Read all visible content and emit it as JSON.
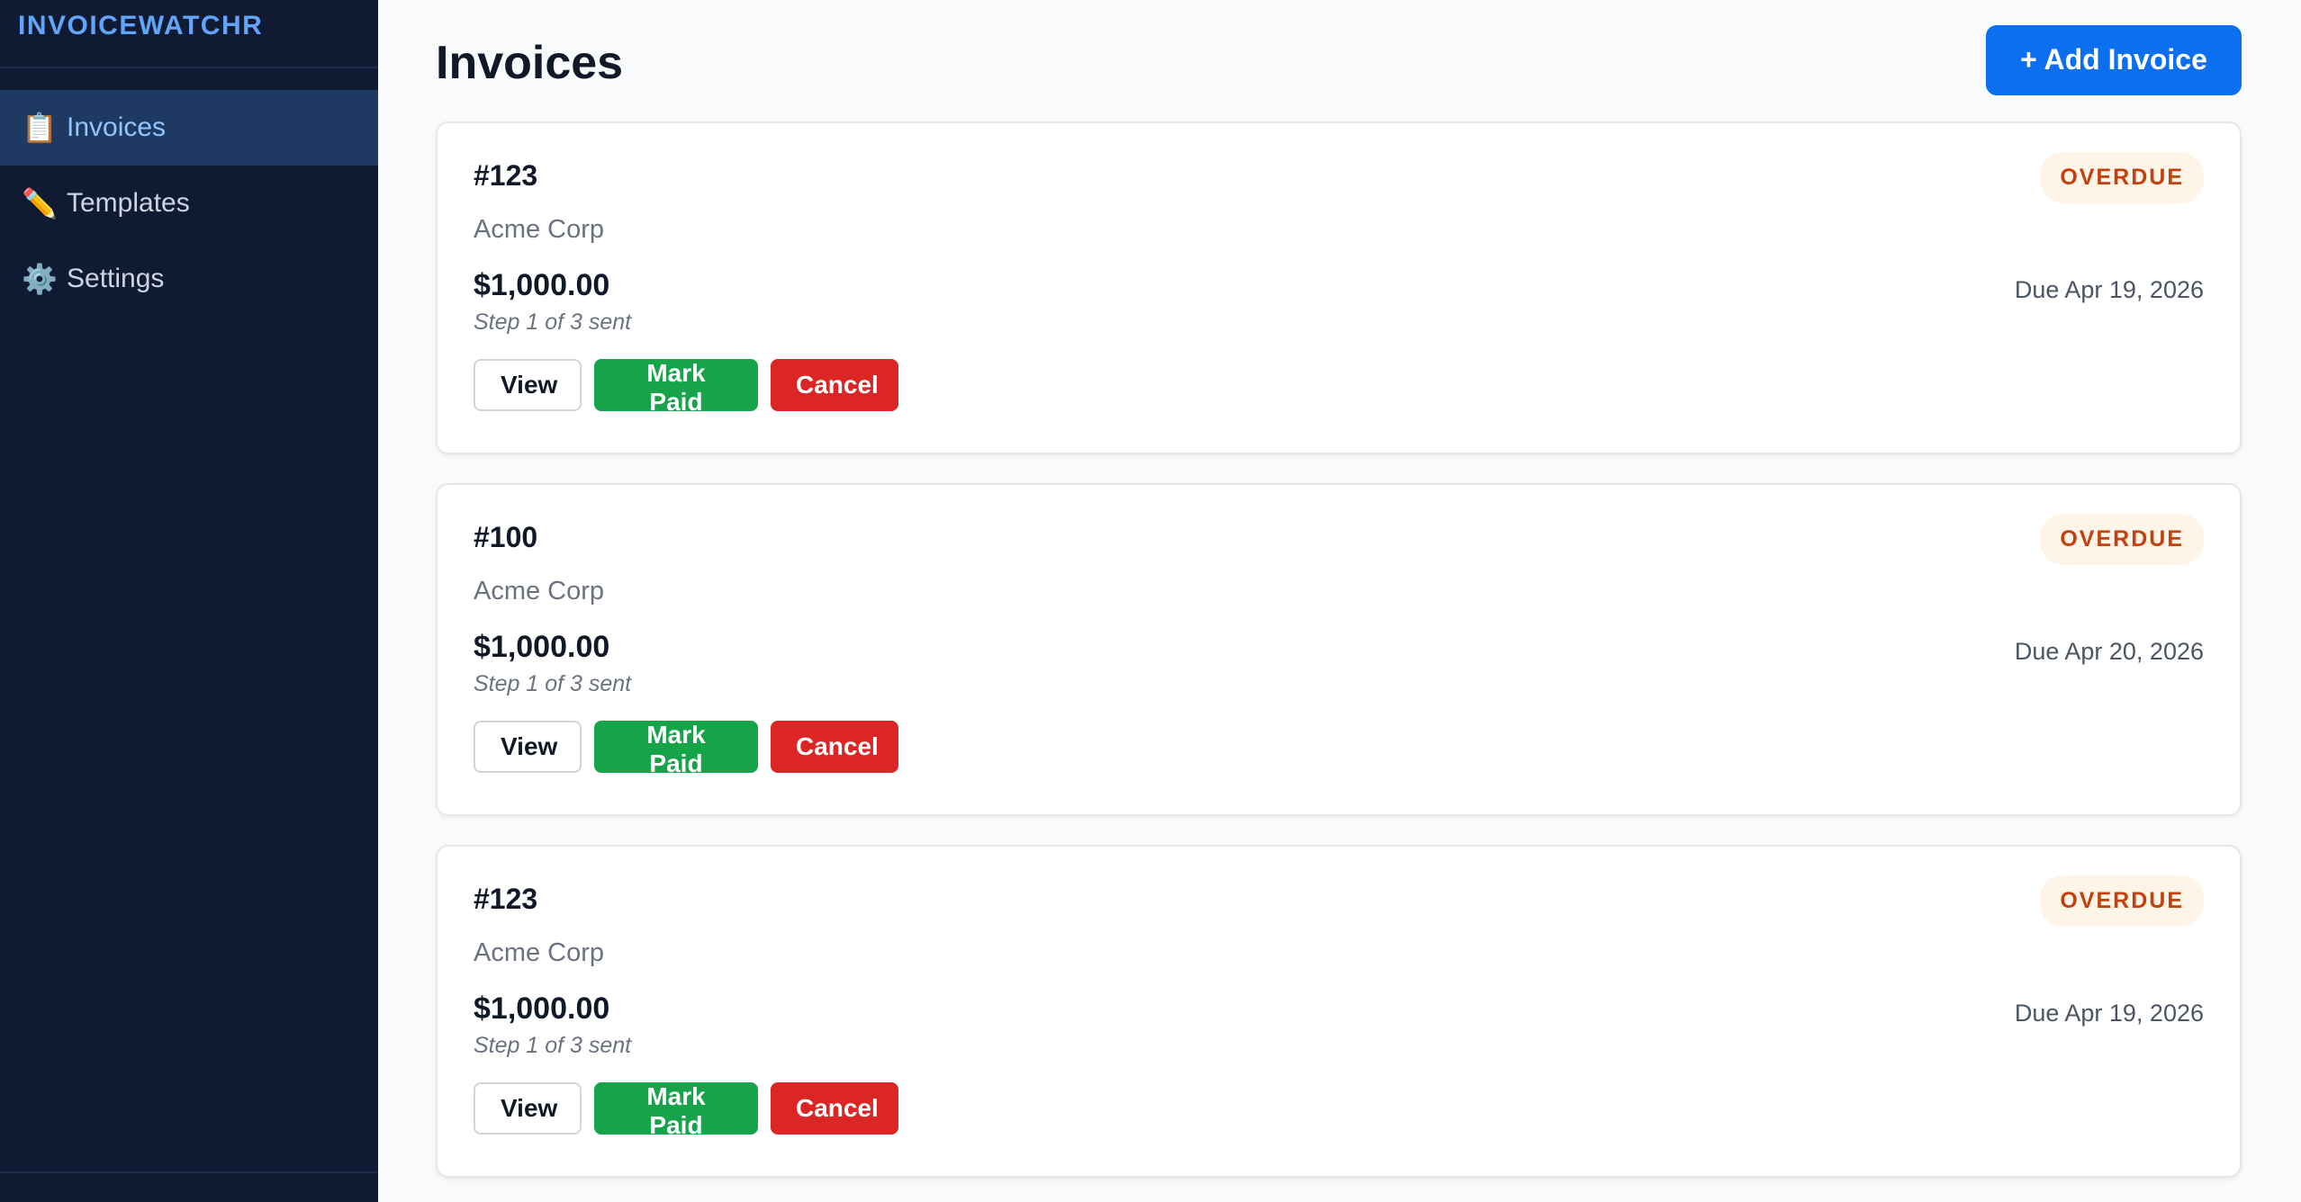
{
  "sidebar": {
    "brand": "INVOICEWATCHR",
    "items": [
      {
        "icon": "clipboard-icon",
        "glyph": "📋",
        "label": "Invoices",
        "active": true
      },
      {
        "icon": "pencil-icon",
        "glyph": "✏️",
        "label": "Templates",
        "active": false
      },
      {
        "icon": "gear-icon",
        "glyph": "⚙️",
        "label": "Settings",
        "active": false
      }
    ]
  },
  "header": {
    "title": "Invoices",
    "add_button": "+ Add Invoice"
  },
  "invoices": [
    {
      "number": "#123",
      "client": "Acme Corp",
      "amount": "$1,000.00",
      "step": "Step 1 of 3 sent",
      "status": "OVERDUE",
      "due": "Due Apr 19, 2026"
    },
    {
      "number": "#100",
      "client": "Acme Corp",
      "amount": "$1,000.00",
      "step": "Step 1 of 3 sent",
      "status": "OVERDUE",
      "due": "Due Apr 20, 2026"
    },
    {
      "number": "#123",
      "client": "Acme Corp",
      "amount": "$1,000.00",
      "step": "Step 1 of 3 sent",
      "status": "OVERDUE",
      "due": "Due Apr 19, 2026"
    }
  ],
  "actions": {
    "view": "View",
    "mark_paid": "Mark Paid",
    "cancel": "Cancel"
  },
  "colors": {
    "sidebar_bg": "#111a33",
    "accent": "#0b6ff0",
    "paid": "#16a34a",
    "cancel": "#dc2626",
    "overdue_text": "#c2410c",
    "overdue_bg": "#fff4e8"
  }
}
